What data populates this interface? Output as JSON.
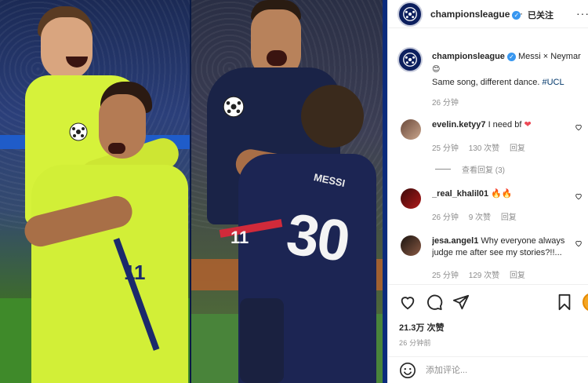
{
  "post": {
    "account": "championsleague",
    "follow_separator": "·",
    "follow_label": "已关注",
    "more_label": "···",
    "caption_user": "championsleague",
    "caption_text": "Messi × Neymar",
    "caption_emoji": "😊",
    "caption_line2": "Same song, different dance.",
    "caption_hashtag": "#UCL",
    "caption_time": "26 分钟"
  },
  "comments": [
    {
      "user": "evelin.ketyy7",
      "text": "I need bf",
      "emoji": "❤",
      "time": "25 分钟",
      "likes": "130 次赞",
      "reply": "回复",
      "view_replies": "查看回复 (3)"
    },
    {
      "user": "_real_khalil01",
      "text": "",
      "emoji": "🔥🔥",
      "time": "26 分钟",
      "likes": "9 次赞",
      "reply": "回复"
    },
    {
      "user": "jesa.angel1",
      "text": "Why everyone always",
      "text2": "judge me after see my stories?!!...",
      "time": "25 分钟",
      "likes": "129 次赞",
      "reply": "回复"
    }
  ],
  "footer": {
    "likes_count": "21.3万 次赞",
    "posted_ago": "26 分钟前",
    "add_comment_placeholder": "添加评论..."
  },
  "photo": {
    "left_jersey_number": "11",
    "right_jersey_name": "MESSI",
    "right_jersey_number": "30",
    "right_jersey_number_back": "11"
  },
  "colors": {
    "verified": "#3897f0",
    "hashtag": "#00376b",
    "heart": "#ed4956",
    "ucl_navy": "#0c1f5e",
    "barca_lime": "#d6f23a"
  },
  "icons": [
    "heart-icon",
    "comment-icon",
    "share-icon",
    "bookmark-icon",
    "emoji-icon",
    "ucl-starball-icon"
  ]
}
